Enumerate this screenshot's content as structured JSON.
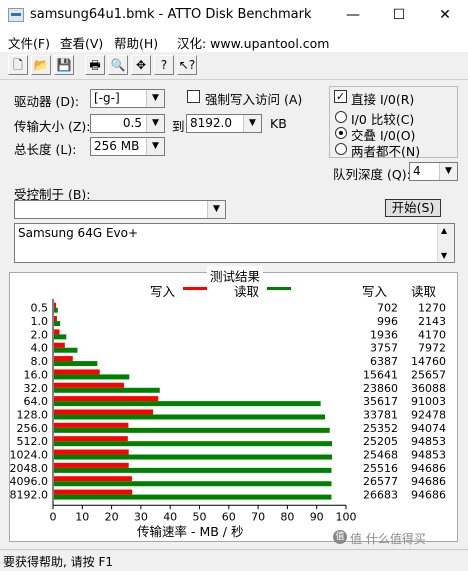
{
  "window": {
    "title": "samsung64u1.bmk - ATTO Disk Benchmark",
    "minimize": "—",
    "maximize": "☐",
    "close": "✕"
  },
  "menu": [
    "文件(F)",
    "查看(V)",
    "帮助(H)",
    "汉化: www.upantool.com"
  ],
  "toolbar": {
    "icons": [
      "new-file-icon",
      "open-folder-icon",
      "save-icon",
      "print-icon",
      "print-preview-icon",
      "move-icon",
      "help-icon",
      "context-help-icon"
    ],
    "glyphs": [
      "🗋",
      "📂",
      "💾",
      "🖶",
      "🔍",
      "✥",
      "?",
      "↖?"
    ]
  },
  "controls": {
    "drive_label": "驱动器 (D):",
    "drive_value": "[-g-]",
    "force_write_label": "强制写入访问 (A)",
    "transfer_size_label": "传输大小 (Z):",
    "transfer_from": "0.5",
    "transfer_to_label": "到",
    "transfer_to": "8192.0",
    "transfer_unit": "KB",
    "total_length_label": "总长度 (L):",
    "total_length_value": "256 MB",
    "direct_io_label": "直接 I/0(R)",
    "direct_io_checked": true,
    "io_compare_label": "I/0 比较(C)",
    "overlapped_io_label": "交叠 I/0(O)",
    "neither_label": "两者都不(N)",
    "io_mode_selected": "overlapped",
    "queue_depth_label": "队列深度 (Q):",
    "queue_depth_value": "4",
    "controlled_by_label": "受控制于 (B):",
    "controlled_by_value": "",
    "start_button": "开始(S)",
    "description": "Samsung 64G Evo+"
  },
  "results": {
    "group_title": "测试结果",
    "legend_write": "写入",
    "legend_read": "读取",
    "col_write": "写入",
    "col_read": "读取"
  },
  "status": {
    "text": "要获得帮助, 请按 F1",
    "watermark": "值 什么值得买"
  },
  "chart_data": {
    "type": "bar",
    "orientation": "horizontal",
    "categories": [
      "0.5",
      "1.0",
      "2.0",
      "4.0",
      "8.0",
      "16.0",
      "32.0",
      "64.0",
      "128.0",
      "256.0",
      "512.0",
      "1024.0",
      "2048.0",
      "4096.0",
      "8192.0"
    ],
    "series": [
      {
        "name": "写入",
        "color": "#ff0000",
        "values": [
          0.7,
          1.0,
          1.9,
          3.7,
          6.4,
          15.6,
          23.9,
          35.6,
          33.8,
          25.4,
          25.2,
          25.5,
          25.5,
          26.6,
          26.7
        ]
      },
      {
        "name": "读取",
        "color": "#008000",
        "values": [
          1.3,
          2.1,
          4.2,
          8.0,
          14.8,
          25.7,
          36.1,
          91.0,
          92.5,
          94.1,
          94.9,
          94.9,
          94.7,
          94.7,
          94.7
        ]
      }
    ],
    "write_values": [
      "702",
      "996",
      "1936",
      "3757",
      "6387",
      "15641",
      "23860",
      "35617",
      "33781",
      "25352",
      "25205",
      "25468",
      "25516",
      "26577",
      "26683"
    ],
    "read_values": [
      "1270",
      "2143",
      "4170",
      "7972",
      "14760",
      "25657",
      "36088",
      "91003",
      "92478",
      "94074",
      "94853",
      "94853",
      "94686",
      "94686",
      "94686"
    ],
    "x_ticks": [
      "0",
      "10",
      "20",
      "30",
      "40",
      "50",
      "60",
      "70",
      "80",
      "90",
      "100"
    ],
    "xlim": [
      0,
      100
    ],
    "xlabel": "传输速率 - MB / 秒",
    "grid": false,
    "legend": "top-center"
  }
}
